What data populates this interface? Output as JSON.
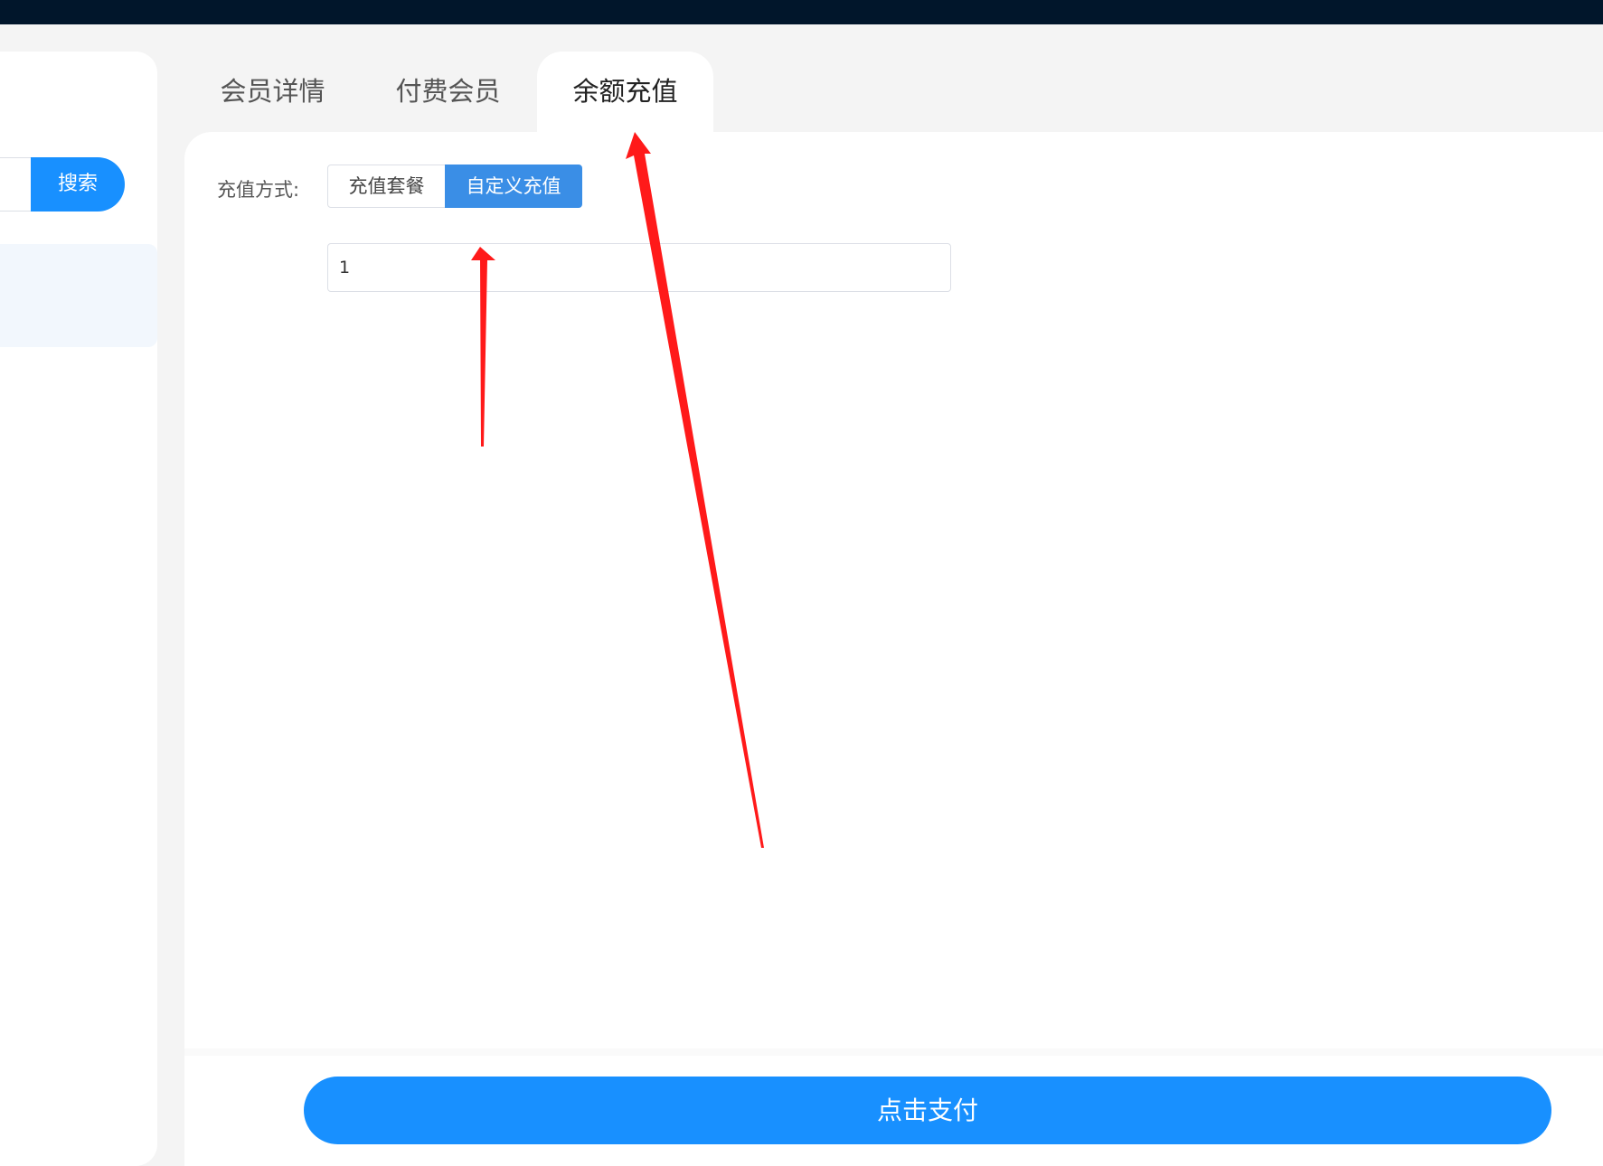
{
  "left_panel": {
    "search_button": "搜索"
  },
  "tabs": [
    {
      "label": "会员详情",
      "active": false
    },
    {
      "label": "付费会员",
      "active": false
    },
    {
      "label": "余额充值",
      "active": true
    }
  ],
  "recharge": {
    "method_label": "充值方式:",
    "options": [
      {
        "label": "充值套餐",
        "selected": false
      },
      {
        "label": "自定义充值",
        "selected": true
      }
    ],
    "amount_value": "1"
  },
  "pay_button": "点击支付",
  "colors": {
    "primary": "#1890ff",
    "topbar": "#01162b",
    "annotation_arrow": "#ff1a1a"
  }
}
